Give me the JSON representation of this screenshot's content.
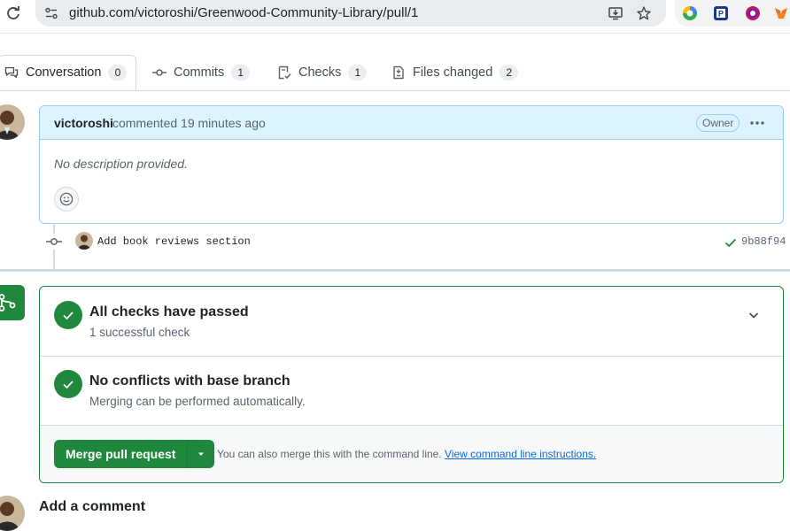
{
  "browser": {
    "url": "github.com/victoroshi/Greenwood-Community-Library/pull/1",
    "extensions": [
      "copilot-icon",
      "pushbullet-icon",
      "colorful-extension-icon",
      "metamask-icon"
    ]
  },
  "tabs": [
    {
      "label": "Conversation",
      "count": "0",
      "icon": "comment-discussion-icon",
      "active": true
    },
    {
      "label": "Commits",
      "count": "1",
      "icon": "git-commit-icon"
    },
    {
      "label": "Checks",
      "count": "1",
      "icon": "checklist-icon"
    },
    {
      "label": "Files changed",
      "count": "2",
      "icon": "file-diff-icon"
    }
  ],
  "comment": {
    "author": "victoroshi",
    "action": "commented 19 minutes ago",
    "badge": "Owner",
    "body": "No description provided."
  },
  "commit": {
    "message": "Add book reviews section",
    "sha": "9b88f94"
  },
  "merge": {
    "checks_title": "All checks have passed",
    "checks_sub": "1 successful check",
    "conflicts_title": "No conflicts with base branch",
    "conflicts_sub": "Merging can be performed automatically.",
    "button_label": "Merge pull request",
    "hint_text": "You can also merge this with the command line.",
    "hint_link": "View command line instructions."
  },
  "add_comment_title": "Add a comment",
  "colors": {
    "success": "#1f883d",
    "link": "#0969da",
    "header_bg": "#ddf4ff",
    "border": "#d1d9e0"
  }
}
